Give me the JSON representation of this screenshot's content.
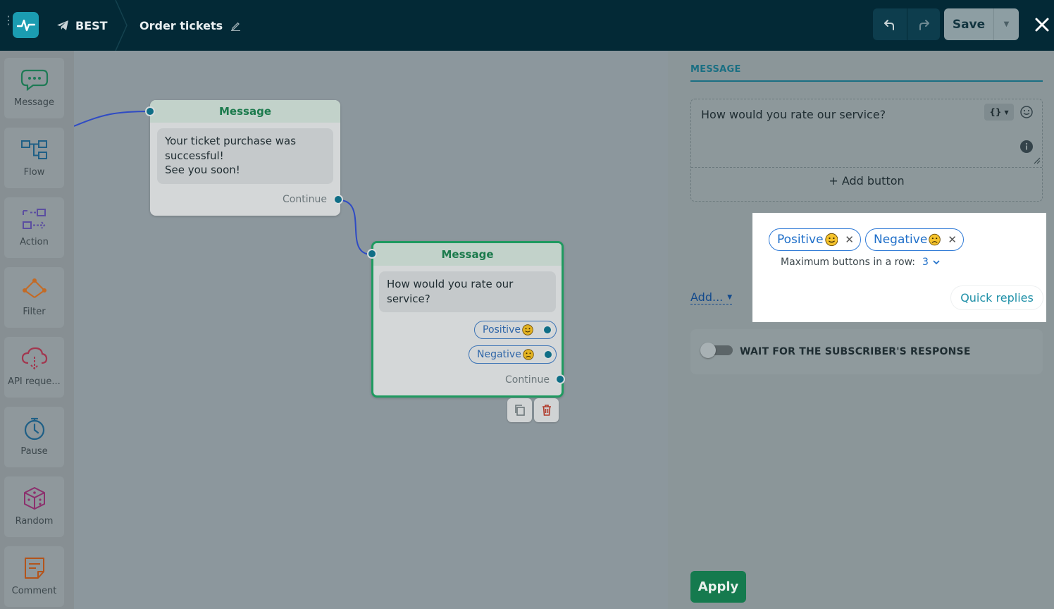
{
  "header": {
    "bot_name": "BEST",
    "flow_title": "Order tickets",
    "save_label": "Save"
  },
  "palette": {
    "items": [
      {
        "label": "Message",
        "icon": "chat-bubble-icon"
      },
      {
        "label": "Flow",
        "icon": "flow-icon"
      },
      {
        "label": "Action",
        "icon": "action-icon"
      },
      {
        "label": "Filter",
        "icon": "filter-icon"
      },
      {
        "label": "API reque...",
        "icon": "cloud-icon"
      },
      {
        "label": "Pause",
        "icon": "stopwatch-icon"
      },
      {
        "label": "Random",
        "icon": "dice-icon"
      },
      {
        "label": "Comment",
        "icon": "note-icon"
      }
    ]
  },
  "canvas": {
    "node1": {
      "title": "Message",
      "text_line1": "Your ticket purchase was",
      "text_line2": "successful!",
      "text_line3": "See you soon!",
      "continue": "Continue"
    },
    "node2": {
      "title": "Message",
      "text_line1": "How would you rate our",
      "text_line2": "service?",
      "button1": "Positive",
      "button2": "Negative",
      "continue": "Continue"
    }
  },
  "panel": {
    "section_title": "MESSAGE",
    "message_text": "How would you rate our service?",
    "add_button_label": "+ Add button",
    "add_menu_label": "Add...",
    "quick_replies": {
      "chips": [
        "Positive",
        "Negative"
      ],
      "max_label": "Maximum buttons in a row:",
      "max_value": "3",
      "type_label": "Quick replies"
    },
    "wait_label": "WAIT FOR THE SUBSCRIBER'S RESPONSE",
    "apply_label": "Apply"
  },
  "colors": {
    "header_bg": "#032936",
    "accent": "#1b9cb1",
    "node_title": "#1b7a4c",
    "apply": "#157a4e",
    "chip_blue": "#1f6fc9"
  }
}
